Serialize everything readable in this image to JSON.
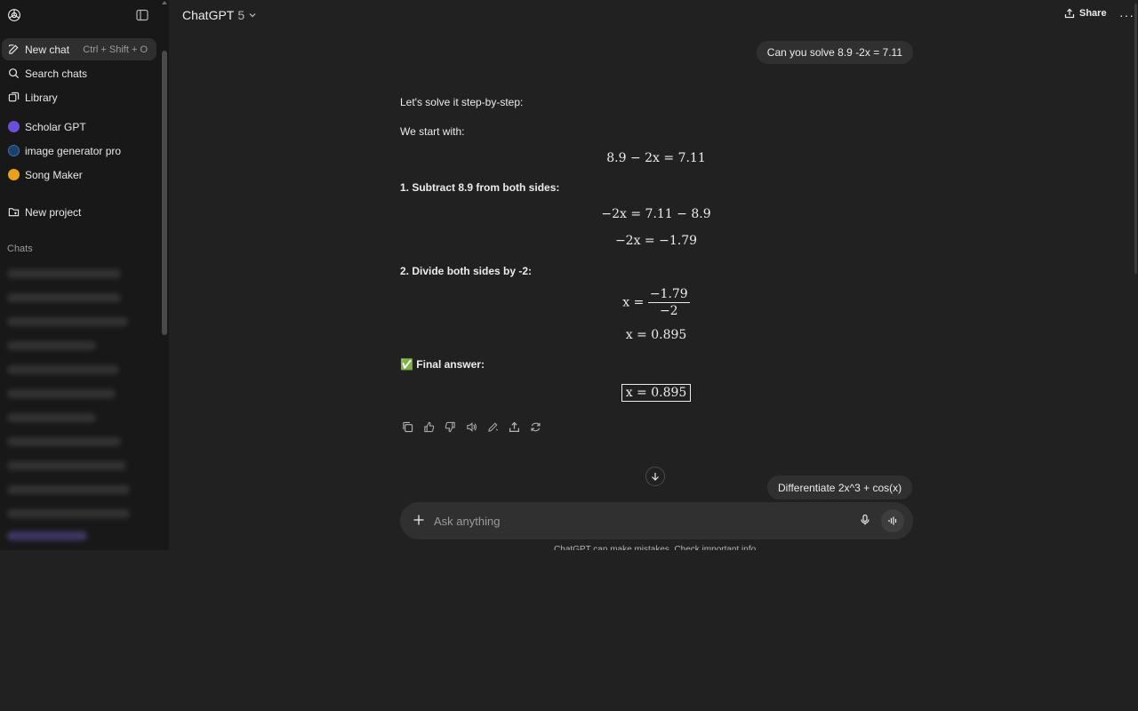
{
  "sidebar": {
    "new_chat": "New chat",
    "new_chat_shortcut": "Ctrl + Shift + O",
    "search_chats": "Search chats",
    "library": "Library",
    "gpts": [
      "Scholar GPT",
      "image generator pro",
      "Song Maker"
    ],
    "new_project": "New project",
    "chats_label": "Chats"
  },
  "header": {
    "model_name": "ChatGPT",
    "model_version": "5",
    "share_label": "Share",
    "more_label": "···"
  },
  "conversation": {
    "user_message": "Can you solve 8.9 -2x = 7.11",
    "intro": "Let's solve it step-by-step:",
    "start": "We start with:",
    "eq1": "8.9 − 2x = 7.11",
    "step1": "1. Subtract 8.9 from both sides:",
    "eq2": "−2x = 7.11 − 8.9",
    "eq3": "−2x = −1.79",
    "step2": "2. Divide both sides by -2:",
    "eq4_lhs": "x =",
    "eq4_num": "−1.79",
    "eq4_den": "−2",
    "eq5": "x = 0.895",
    "final_label": "✅ Final answer:",
    "final_eq": "x = 0.895"
  },
  "suggestion": "Differentiate 2x^3 + cos(x)",
  "composer": {
    "placeholder": "Ask anything"
  },
  "disclaimer": "ChatGPT can make mistakes. Check important info.",
  "colors": {
    "background": "#212121",
    "sidebar": "#181818",
    "bubble": "#303030",
    "text": "#ececec"
  }
}
